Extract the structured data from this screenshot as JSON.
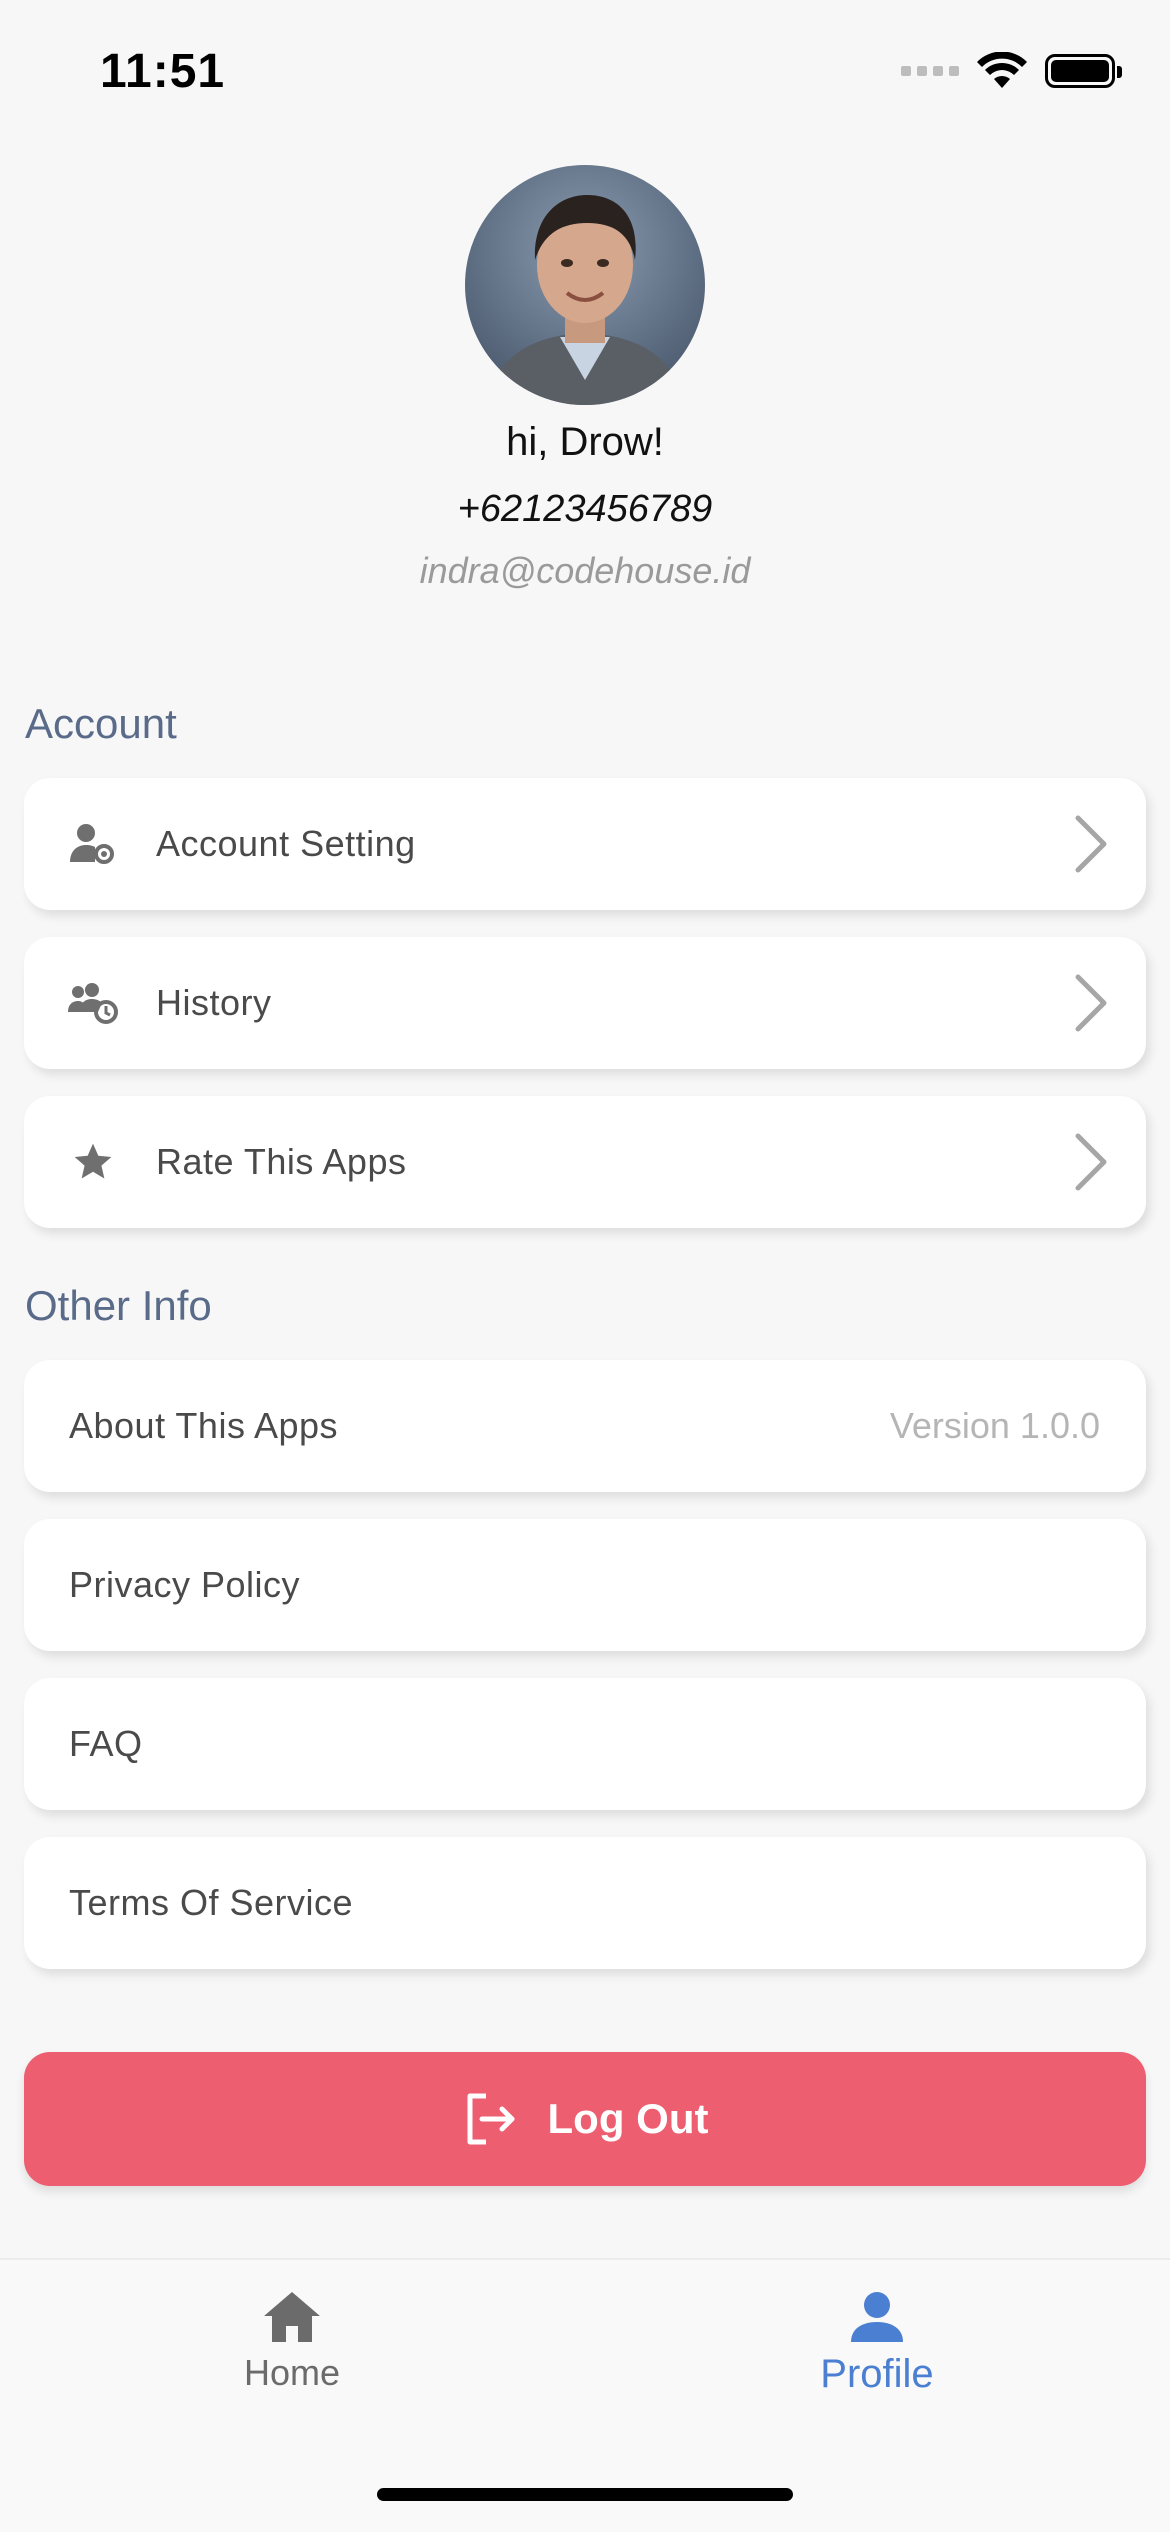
{
  "status_bar": {
    "time": "11:51"
  },
  "profile": {
    "greeting": "hi, Drow!",
    "phone": "+62123456789",
    "email": "indra@codehouse.id"
  },
  "account_section": {
    "title": "Account",
    "items": [
      {
        "label": "Account Setting",
        "icon": "user-settings-icon"
      },
      {
        "label": "History",
        "icon": "users-clock-icon"
      },
      {
        "label": "Rate This Apps",
        "icon": "star-icon"
      }
    ]
  },
  "other_section": {
    "title": "Other Info",
    "items": [
      {
        "label": "About This Apps",
        "value": "Version 1.0.0"
      },
      {
        "label": "Privacy Policy"
      },
      {
        "label": "FAQ"
      },
      {
        "label": "Terms Of Service"
      }
    ]
  },
  "logout": {
    "label": "Log Out",
    "color": "#ec5e70"
  },
  "bottom_nav": {
    "items": [
      {
        "label": "Home",
        "icon": "home-icon",
        "active": false
      },
      {
        "label": "Profile",
        "icon": "person-icon",
        "active": true
      }
    ],
    "active_color": "#4a7fd1",
    "inactive_color": "#6b6b6b"
  }
}
